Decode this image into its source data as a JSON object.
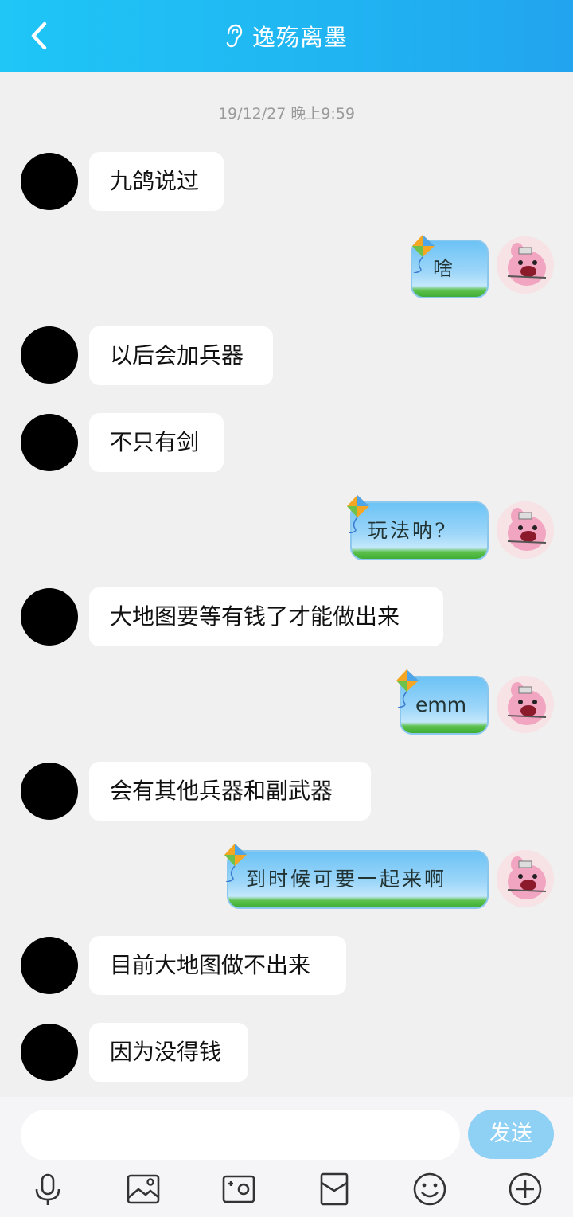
{
  "header": {
    "title": "逸殇离墨",
    "background_color": "#20b4f2"
  },
  "timestamp": "19/12/27 晚上9:59",
  "messages": [
    {
      "side": "left",
      "text": "九鸽说过"
    },
    {
      "side": "right",
      "text": "啥"
    },
    {
      "side": "left",
      "text": "以后会加兵器"
    },
    {
      "side": "left",
      "text": "不只有剑"
    },
    {
      "side": "right",
      "text": "玩法呐?"
    },
    {
      "side": "left",
      "text": "大地图要等有钱了才能做出来"
    },
    {
      "side": "right",
      "text": "emm"
    },
    {
      "side": "left",
      "text": "会有其他兵器和副武器"
    },
    {
      "side": "right",
      "text": "到时候可要一起来啊"
    },
    {
      "side": "left",
      "text": "目前大地图做不出来"
    },
    {
      "side": "left",
      "text": "因为没得钱"
    }
  ],
  "input": {
    "value": "",
    "placeholder": ""
  },
  "send_button": {
    "label": "发送",
    "color": "#8fd0f5"
  },
  "toolbar": [
    "microphone-icon",
    "image-icon",
    "camera-icon",
    "red-packet-icon",
    "emoji-icon",
    "plus-icon"
  ]
}
